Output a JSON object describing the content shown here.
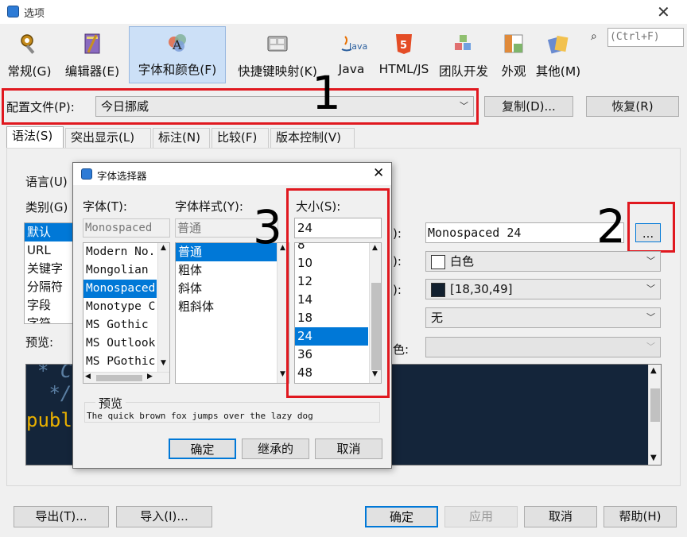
{
  "window": {
    "title": "选项",
    "close": "✕"
  },
  "categories": [
    {
      "label": "常规(G)",
      "icon": "gear-wrench-icon"
    },
    {
      "label": "编辑器(E)",
      "icon": "editor-icon"
    },
    {
      "label": "字体和颜色(F)",
      "icon": "fonts-colors-icon",
      "selected": true
    },
    {
      "label": "快捷键映射(K)",
      "icon": "keymap-icon"
    },
    {
      "label": "Java",
      "icon": "java-icon"
    },
    {
      "label": "HTML/JS",
      "icon": "html5-icon"
    },
    {
      "label": "团队开发",
      "icon": "team-icon"
    },
    {
      "label": "外观",
      "icon": "appearance-icon"
    },
    {
      "label": "其他(M)",
      "icon": "misc-icon"
    }
  ],
  "search": {
    "text": "(Ctrl+F)",
    "icon": "⌕"
  },
  "profile": {
    "label": "配置文件(P):",
    "value": "今日挪威",
    "copy": "复制(D)...",
    "restore": "恢复(R)"
  },
  "tabs": [
    "语法(S)",
    "突出显示(L)",
    "标注(N)",
    "比较(F)",
    "版本控制(V)"
  ],
  "syntax": {
    "language_label": "语言(U)",
    "category_label": "类别(G)",
    "categories": [
      "默认",
      "URL",
      "关键字",
      "分隔符",
      "字段",
      "字符"
    ],
    "preview_label": "预览:",
    "font_label": "):",
    "font_value": "Monospaced 24",
    "browse": "...",
    "fg_label": "):",
    "fg_value": "白色",
    "fg_color": "#ffffff",
    "bg_label": "):",
    "bg_value": "[18,30,49]",
    "bg_color": "#12202f",
    "effect_value": "无",
    "effect_color_label": "色:",
    "code_lines": [
      "* C",
      " */",
      "publ"
    ]
  },
  "font_dialog": {
    "title": "字体选择器",
    "font_label": "字体(T):",
    "style_label": "字体样式(Y):",
    "size_label": "大小(S):",
    "font_value": "Monospaced",
    "style_value": "普通",
    "size_value": "24",
    "fonts": [
      "Modern No.",
      "Mongolian",
      "Monospaced",
      "Monotype C",
      "MS Gothic",
      "MS Outlook",
      "MS PGothic"
    ],
    "selected_font": "Monospaced",
    "styles": [
      "普通",
      "粗体",
      "斜体",
      "粗斜体"
    ],
    "selected_style": "普通",
    "sizes": [
      "8",
      "10",
      "12",
      "14",
      "18",
      "24",
      "36",
      "48"
    ],
    "selected_size": "24",
    "preview_title": "预览",
    "preview_text": "The quick brown fox jumps over the lazy dog",
    "ok": "确定",
    "inherit": "继承的",
    "cancel": "取消",
    "close": "✕"
  },
  "annotations": {
    "n1": "1",
    "n2": "2",
    "n3": "3"
  },
  "bottom": {
    "export": "导出(T)...",
    "import": "导入(I)...",
    "ok": "确定",
    "apply": "应用",
    "cancel": "取消",
    "help": "帮助(H)"
  },
  "colors": {
    "accent": "#0078d7",
    "annotation_red": "#e0181f",
    "editor_bg": "#14253a"
  }
}
